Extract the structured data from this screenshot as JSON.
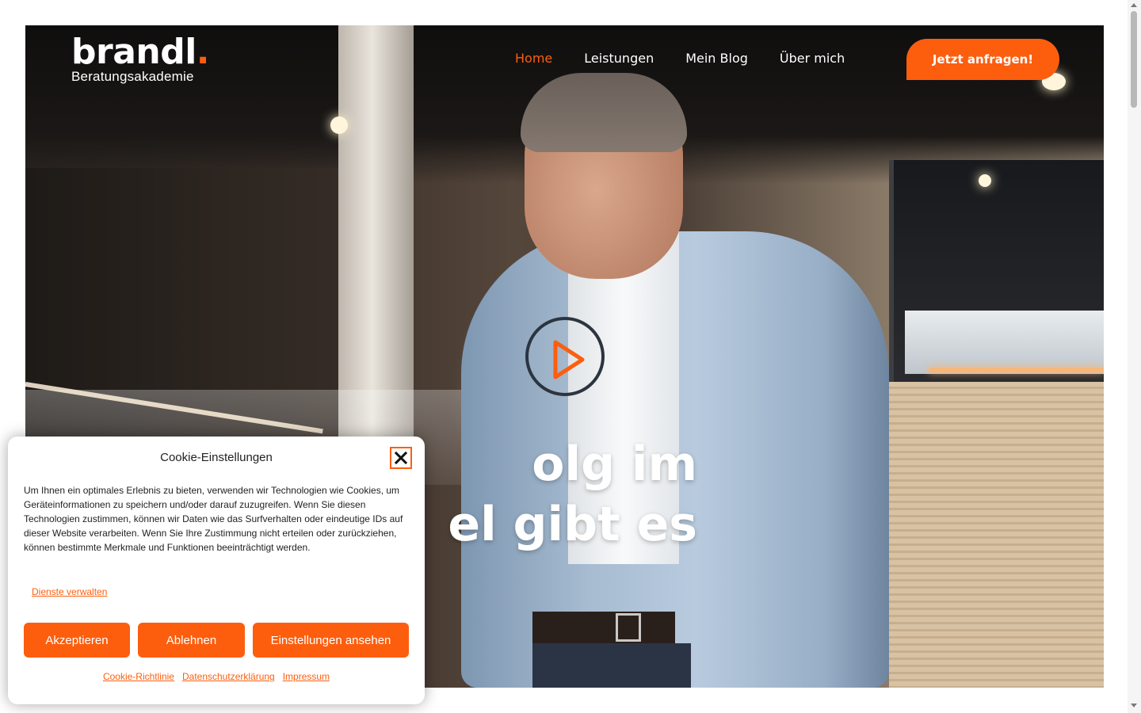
{
  "brand": {
    "name": "brandl",
    "dot": ".",
    "subtitle": "Beratungsakademie",
    "accent_color": "#fc5e0e"
  },
  "nav": {
    "items": [
      {
        "label": "Home",
        "active": true
      },
      {
        "label": "Leistungen",
        "active": false
      },
      {
        "label": "Mein Blog",
        "active": false
      },
      {
        "label": "Über mich",
        "active": false
      }
    ],
    "cta_label": "Jetzt anfragen!"
  },
  "hero": {
    "play_icon": "play-icon",
    "headline_line1": "olg im",
    "headline_line2": "el gibt es"
  },
  "cookie": {
    "title": "Cookie-Einstellungen",
    "close_icon": "close-icon",
    "text": "Um Ihnen ein optimales Erlebnis zu bieten, verwenden wir Technologien wie Cookies, um Geräteinformationen zu speichern und/oder darauf zuzugreifen. Wenn Sie diesen Technologien zustimmen, können wir Daten wie das Surfverhalten oder eindeutige IDs auf dieser Website verarbeiten. Wenn Sie Ihre Zustimmung nicht erteilen oder zurückziehen, können bestimmte Merkmale und Funktionen beeinträchtigt werden.",
    "manage_link": "Dienste verwalten",
    "buttons": {
      "accept": "Akzeptieren",
      "decline": "Ablehnen",
      "settings": "Einstellungen ansehen"
    },
    "links": {
      "cookie_policy": "Cookie-Richtlinie",
      "privacy": "Datenschutzerklärung",
      "imprint": "Impressum"
    }
  }
}
